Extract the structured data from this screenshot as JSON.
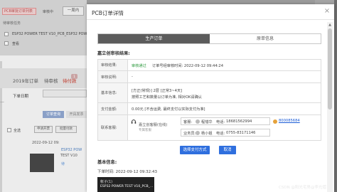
{
  "background": {
    "tag": "PCB审批订单列表",
    "review_label": "审核中",
    "week_button": "一周内",
    "tasks_header": "待审核任务",
    "row1": "ESP32 POWER TEST V10_PCB_ESP32 POWER",
    "row2": "查看",
    "year_tab": "2019年订单",
    "tab2": "待审核",
    "tab3": "待付款",
    "badge": "1",
    "order_date_label": "下单日期",
    "btn_order": "订单查询",
    "btn_invoice": "开具发票",
    "select_all": "全选",
    "mini_btn1": "申请开票",
    "mini_btn2": "批量付款",
    "date": "2022-09-12 09:",
    "link": "ESP32 POW",
    "link2": "TEST V10",
    "status": "待",
    "dash": "—"
  },
  "modal": {
    "title": "PCB订单详情",
    "close": "×",
    "tabs": [
      "生产订单",
      "原单信息"
    ],
    "review_section": "嘉立创审核结果:",
    "rows": {
      "result_label": "审核结果:",
      "result_status": "审核通过",
      "result_detail": "订单号经审核时间: 2022-09-12 09:44:24",
      "remark_label": "审核说明:",
      "remark_value": "-",
      "cycle_label": "基本信息:",
      "cycle_line1": "[方正(常规)]  2层  [正常3~4天]",
      "cycle_line2": "按照工艺和数量以订单为准, 相对OK请确认",
      "price_label": "支付金额:",
      "price_value": "0.00元  [不含运费, 最终支付以实际支付为准]",
      "contact_label": "联系客服:",
      "contact_name": "嘉立创客服(在线)",
      "contact_sub": "专属客服",
      "service_label": "客服:",
      "service_name": "程惜华",
      "service_phone_label": "电话:",
      "service_phone": "18681562994",
      "service_qq": "800085684",
      "sales_label": "业务员:",
      "sales_name": "杨小姐",
      "sales_phone_label": "电话:",
      "sales_phone": "0755-83171146"
    },
    "btn_pay": "选择支付方式",
    "btn_cancel": "取消",
    "basic_section": "基本信息:",
    "basic_date": "下单时间: 2022-09-12 09:32:43",
    "goods_header": "帐子(1)",
    "goods_name": "ESP32 POWER TEST V10_PCB_..."
  },
  "watermark": "CSDN @阳光宅男@李光熠"
}
